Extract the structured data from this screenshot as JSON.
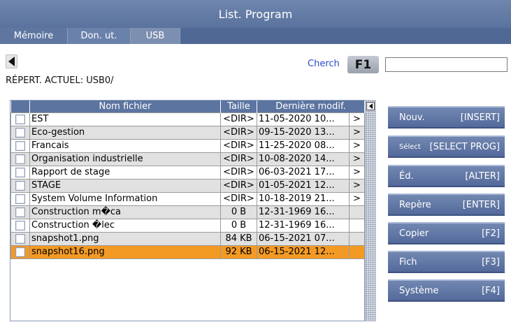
{
  "window": {
    "title": "List. Program"
  },
  "tabs": [
    "Mémoire",
    "Don. ut.",
    "USB"
  ],
  "nav": {
    "current_dir": "RÉPERT. ACTUEL: USB0/"
  },
  "search": {
    "label": "Cherch",
    "key": "F1",
    "value": ""
  },
  "table": {
    "headers": {
      "name": "Nom fichier",
      "size": "Taille",
      "modified": "Dernière modif."
    },
    "rows": [
      {
        "name": "EST",
        "size": "<DIR>",
        "modified": "11-05-2020 10...",
        "arrow": ">"
      },
      {
        "name": "Eco-gestion",
        "size": "<DIR>",
        "modified": "09-15-2020 13...",
        "arrow": ">"
      },
      {
        "name": "Francais",
        "size": "<DIR>",
        "modified": "11-25-2020 08...",
        "arrow": ">"
      },
      {
        "name": "Organisation industrielle",
        "size": "<DIR>",
        "modified": "10-08-2020 14...",
        "arrow": ">"
      },
      {
        "name": "Rapport de stage",
        "size": "<DIR>",
        "modified": "06-03-2021 17...",
        "arrow": ">"
      },
      {
        "name": "STAGE",
        "size": "<DIR>",
        "modified": "01-05-2021 12...",
        "arrow": ">"
      },
      {
        "name": "System Volume Information",
        "size": "<DIR>",
        "modified": "10-18-2019 21...",
        "arrow": ">"
      },
      {
        "name": "Construction m�ca",
        "size": "0 B",
        "modified": "12-31-1969 16...",
        "arrow": ""
      },
      {
        "name": "Construction �lec",
        "size": "0 B",
        "modified": "12-31-1969 16...",
        "arrow": ""
      },
      {
        "name": "snapshot1.png",
        "size": "84 KB",
        "modified": "06-15-2021 07...",
        "arrow": ""
      },
      {
        "name": "snapshot16.png",
        "size": "92 KB",
        "modified": "06-15-2021 12...",
        "arrow": ""
      }
    ]
  },
  "softkeys": [
    {
      "name": "Nouv.",
      "key": "[INSERT]"
    },
    {
      "name": "Sélect",
      "key": "[SELECT PROG]"
    },
    {
      "name": "Éd.",
      "key": "[ALTER]"
    },
    {
      "name": "Repère",
      "key": "[ENTER]"
    },
    {
      "name": "Copier",
      "key": "[F2]"
    },
    {
      "name": "Fich",
      "key": "[F3]"
    },
    {
      "name": "Système",
      "key": "[F4]"
    }
  ],
  "colors": {
    "header_blue": "#5a739e",
    "selected_row": "#f39a25",
    "search_label": "#2a49c8"
  }
}
